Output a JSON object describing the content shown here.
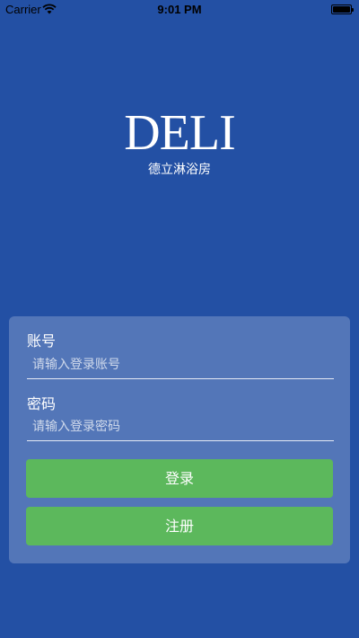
{
  "status_bar": {
    "carrier": "Carrier",
    "time": "9:01 PM",
    "wifi_icon": "wifi-icon",
    "battery_icon": "battery-full-icon"
  },
  "brand": {
    "logo": "DELI",
    "subtitle": "德立淋浴房"
  },
  "login": {
    "account_label": "账号",
    "account_placeholder": "请输入登录账号",
    "account_value": "",
    "password_label": "密码",
    "password_placeholder": "请输入登录密码",
    "password_value": "",
    "login_button": "登录",
    "register_button": "注册"
  },
  "colors": {
    "background": "#2350a4",
    "button": "#5cb85c",
    "text": "#ffffff"
  }
}
